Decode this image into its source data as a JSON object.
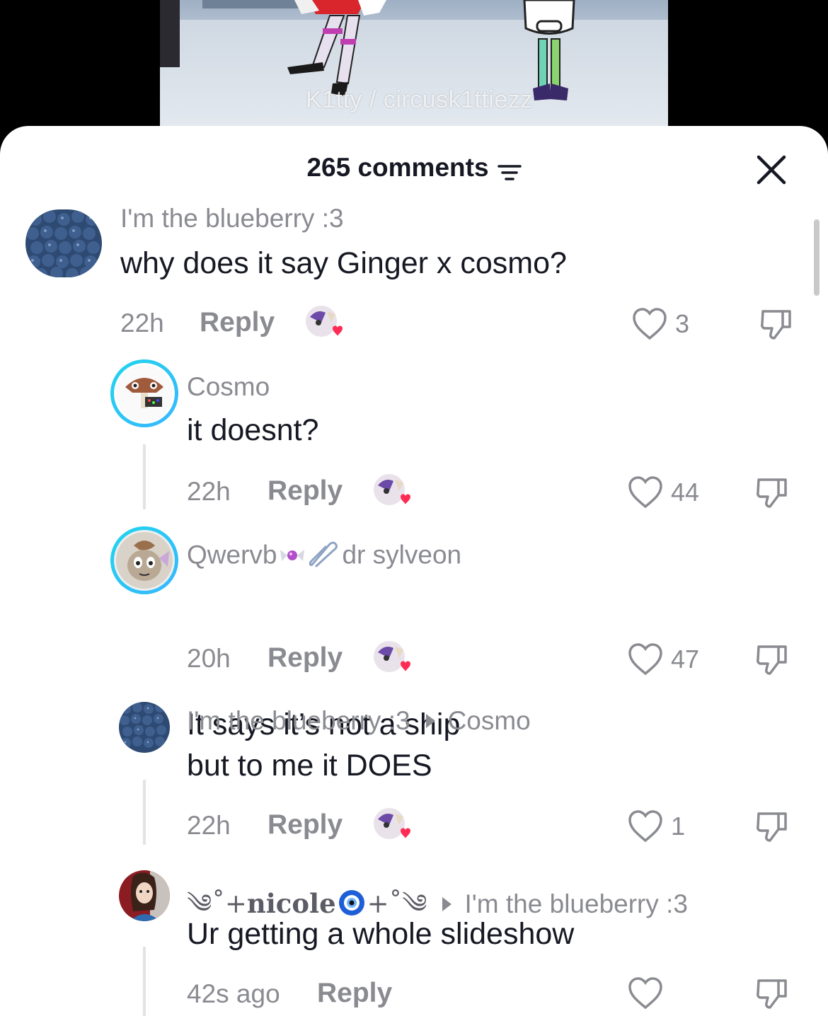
{
  "video": {
    "watermark": "K1tty / circusk1ttiezz"
  },
  "sheet": {
    "comments_count": "265 comments",
    "filter_icon": "filter-icon",
    "close_icon": "close-icon"
  },
  "colors": {
    "text_primary": "#161823",
    "text_secondary": "#8a8b91",
    "like_heart_red": "#fe2c55",
    "story_ring_start": "#20d5ec",
    "story_ring_end": "#38b6ff"
  },
  "comments": [
    {
      "username": "I'm the blueberry :3",
      "text": "why does it say Ginger x cosmo?",
      "time": "22h",
      "reply_label": "Reply",
      "likes": "3"
    },
    {
      "username": "Cosmo",
      "text": "it doesnt?",
      "time": "22h",
      "reply_label": "Reply",
      "likes": "44"
    },
    {
      "username": "Qwervb",
      "username_suffix": "dr sylveon",
      "text": "It says it’s not a ship",
      "time": "20h",
      "reply_label": "Reply",
      "likes": "47"
    },
    {
      "username": "I'm the blueberry :3",
      "reply_to": "Cosmo",
      "text": "but to me it DOES",
      "time": "22h",
      "reply_label": "Reply",
      "likes": "1"
    },
    {
      "username_prefix": "༄˚+",
      "username": "nicole",
      "username_suffix": "+˚༄",
      "reply_to": "I'm the blueberry :3",
      "text": "Ur getting a whole slideshow",
      "time": "42s ago",
      "reply_label": "Reply",
      "likes": ""
    }
  ]
}
